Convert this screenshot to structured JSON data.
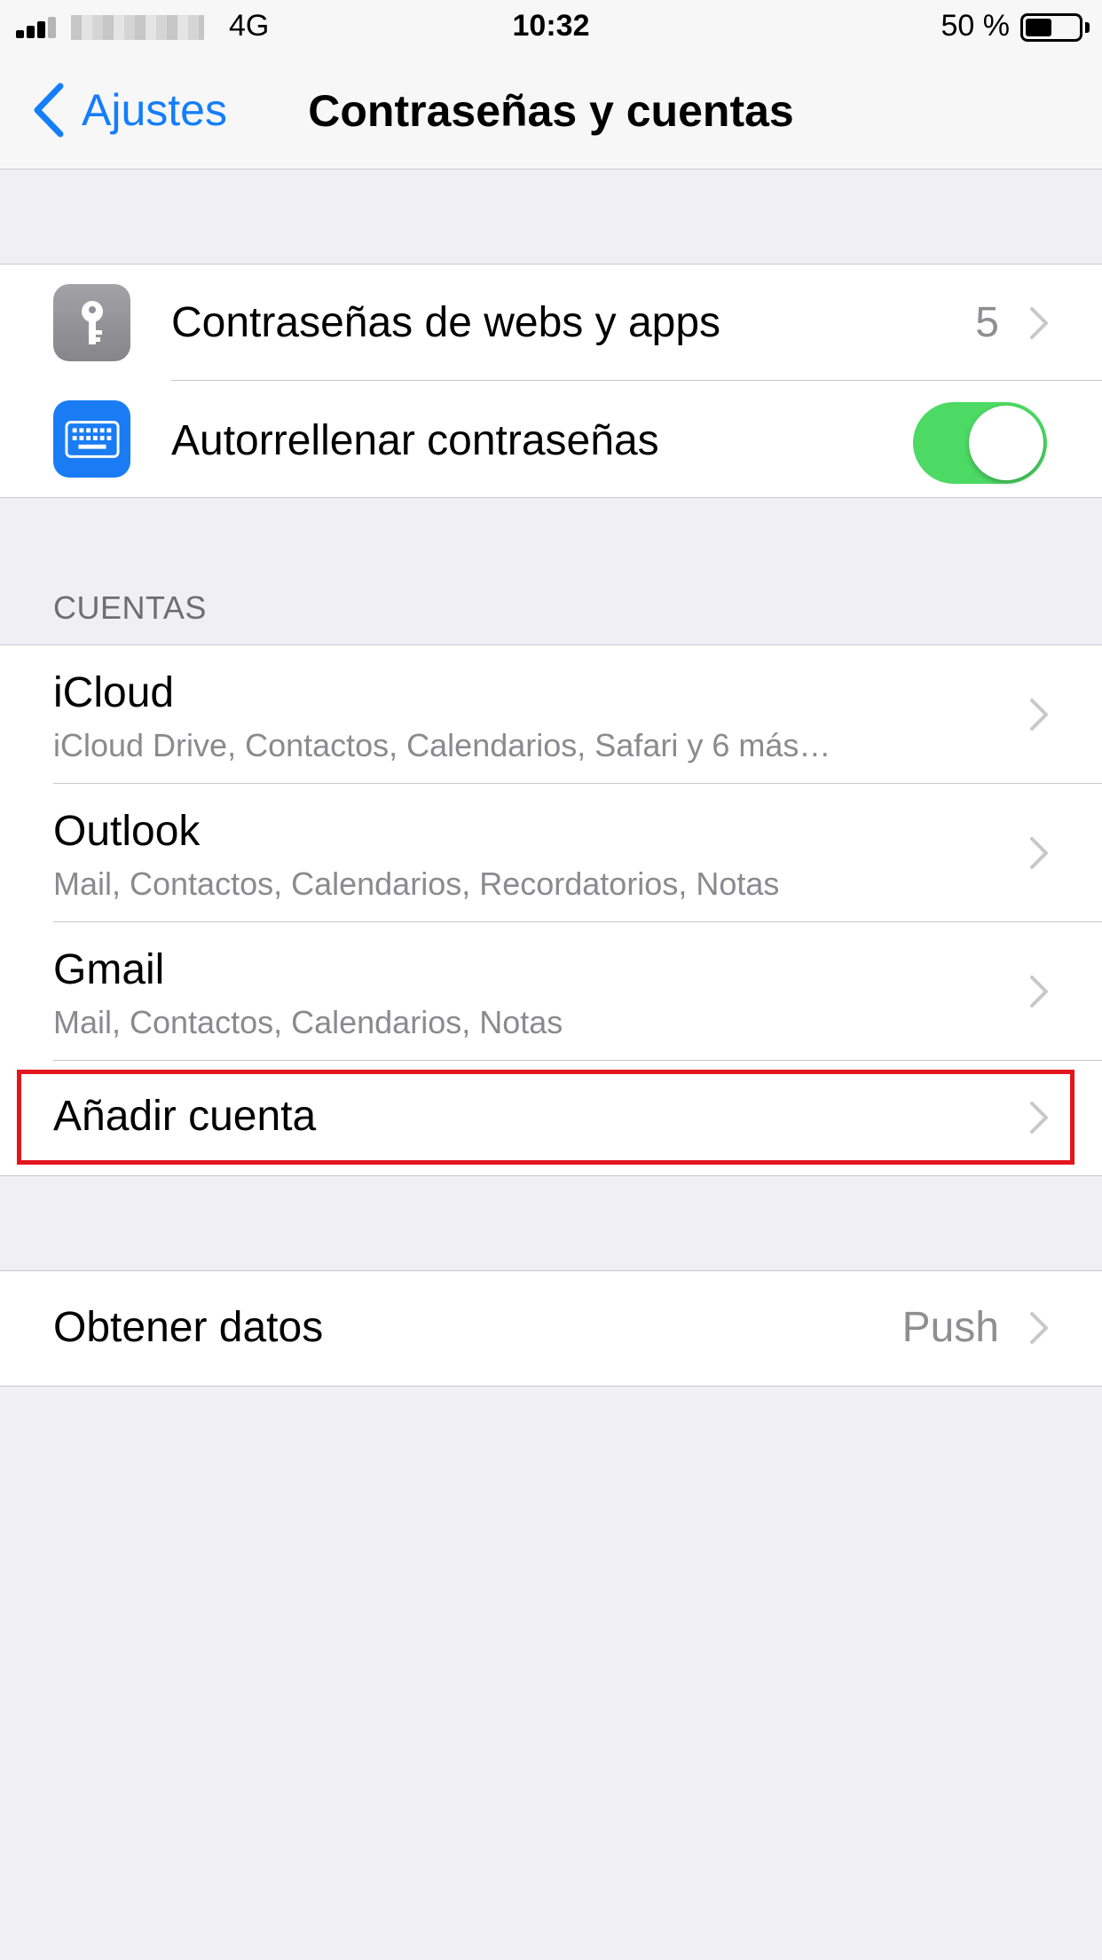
{
  "status_bar": {
    "network": "4G",
    "time": "10:32",
    "battery_percent": "50 %",
    "battery_level": 0.5
  },
  "nav": {
    "back_label": "Ajustes",
    "title": "Contraseñas y cuentas"
  },
  "passwords_group": {
    "web_app_passwords": {
      "label": "Contraseñas de webs y apps",
      "value": "5",
      "icon": "key-icon"
    },
    "autofill": {
      "label": "Autorrellenar contraseñas",
      "toggle_on": true,
      "icon": "keyboard-icon"
    }
  },
  "accounts_section": {
    "header": "CUENTAS",
    "accounts": [
      {
        "name": "iCloud",
        "services": "iCloud Drive, Contactos, Calendarios, Safari y 6 más…"
      },
      {
        "name": "Outlook",
        "services": "Mail, Contactos, Calendarios, Recordatorios, Notas"
      },
      {
        "name": "Gmail",
        "services": "Mail, Contactos, Calendarios, Notas"
      }
    ],
    "add_account": "Añadir cuenta"
  },
  "fetch_group": {
    "label": "Obtener datos",
    "value": "Push"
  },
  "colors": {
    "accent": "#147efb",
    "toggle_on": "#4cd964",
    "highlight": "#e3161e",
    "background": "#efeff4"
  }
}
